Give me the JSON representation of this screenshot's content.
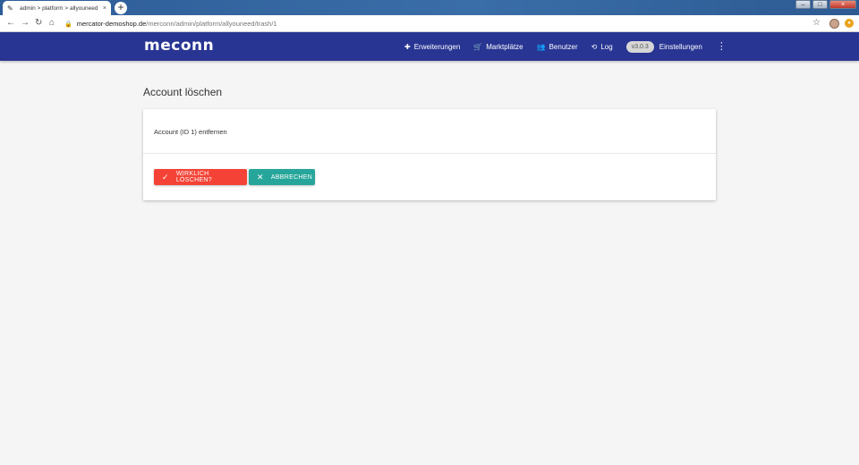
{
  "browser": {
    "tab_title": "admin > platform > allyouneed",
    "tab_favicon": "✎",
    "tab_close": "×",
    "new_tab": "+",
    "url_host": "mercator-demoshop.de",
    "url_path": "/merconn/admin/platform/allyouneed/trash/1",
    "icons": {
      "back": "←",
      "forward": "→",
      "reload": "↻",
      "home": "⌂",
      "lock": "🔒",
      "star": "☆"
    }
  },
  "app": {
    "logo": "meconn",
    "nav": [
      {
        "label": "Erweiterungen",
        "icon": "puzzle-icon",
        "glyph": "✚"
      },
      {
        "label": "Marktplätze",
        "icon": "cart-icon",
        "glyph": "🛒"
      },
      {
        "label": "Benutzer",
        "icon": "users-icon",
        "glyph": "👥"
      },
      {
        "label": "Log",
        "icon": "history-icon",
        "glyph": "⟲"
      }
    ],
    "version": "v3.0.3",
    "settings_label": "Einstellungen",
    "more_glyph": "⋮",
    "colors": {
      "header": "#283593",
      "delete": "#f44336",
      "cancel": "#26a69a"
    }
  },
  "page": {
    "title": "Account löschen",
    "message": "Account (ID 1) entfernen",
    "delete_button": {
      "label": "WIRKLICH LÖSCHEN?",
      "icon": "check-icon",
      "glyph": "✓"
    },
    "cancel_button": {
      "label": "ABBRECHEN",
      "icon": "close-icon",
      "glyph": "✕"
    }
  }
}
